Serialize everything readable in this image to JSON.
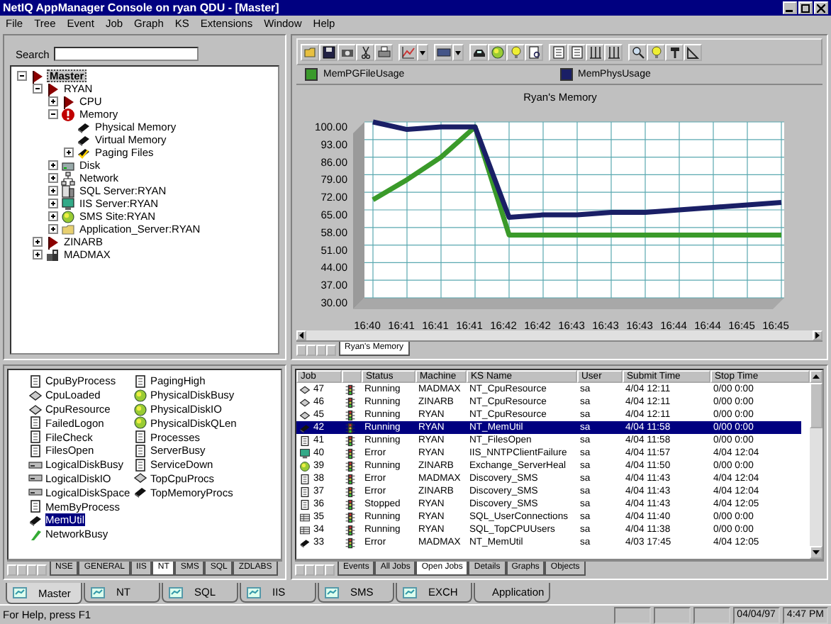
{
  "window": {
    "title": "NetIQ AppManager Console on ryan QDU - [Master]"
  },
  "menu": [
    "File",
    "Tree",
    "Event",
    "Job",
    "Graph",
    "KS",
    "Extensions",
    "Window",
    "Help"
  ],
  "search": {
    "label": "Search"
  },
  "tree": [
    {
      "label": "Master",
      "kind": "flag",
      "expanded": true,
      "selected": true,
      "children": [
        {
          "label": "RYAN",
          "kind": "flag",
          "expanded": true,
          "selected": false,
          "children": [
            {
              "label": "CPU",
              "kind": "flag",
              "expanded": false,
              "selected": false
            },
            {
              "label": "Memory",
              "kind": "alert",
              "expanded": true,
              "selected": false,
              "children": [
                {
                  "label": "Physical Memory",
                  "kind": "chip",
                  "selected": false
                },
                {
                  "label": "Virtual Memory",
                  "kind": "chip",
                  "selected": false
                },
                {
                  "label": "Paging Files",
                  "kind": "chipcheck",
                  "expanded": false,
                  "selected": false
                }
              ]
            },
            {
              "label": "Disk",
              "kind": "disk",
              "expanded": false,
              "selected": false
            },
            {
              "label": "Network",
              "kind": "network",
              "expanded": false,
              "selected": false
            },
            {
              "label": "SQL Server:RYAN",
              "kind": "server",
              "expanded": false,
              "selected": false
            },
            {
              "label": "IIS Server:RYAN",
              "kind": "monitor",
              "expanded": false,
              "selected": false
            },
            {
              "label": "SMS Site:RYAN",
              "kind": "globe",
              "expanded": false,
              "selected": false
            },
            {
              "label": "Application_Server:RYAN",
              "kind": "folder",
              "expanded": false,
              "selected": false
            }
          ]
        },
        {
          "label": "ZINARB",
          "kind": "flag",
          "expanded": false,
          "selected": false
        },
        {
          "label": "MADMAX",
          "kind": "machine",
          "expanded": false,
          "selected": false
        }
      ]
    }
  ],
  "scripts": {
    "items": [
      {
        "label": "CpuByProcess",
        "kind": "page",
        "selected": false
      },
      {
        "label": "CpuLoaded",
        "kind": "diamond",
        "selected": false
      },
      {
        "label": "CpuResource",
        "kind": "diamond",
        "selected": false
      },
      {
        "label": "FailedLogon",
        "kind": "page",
        "selected": false
      },
      {
        "label": "FileCheck",
        "kind": "page",
        "selected": false
      },
      {
        "label": "FilesOpen",
        "kind": "page",
        "selected": false
      },
      {
        "label": "LogicalDiskBusy",
        "kind": "drive",
        "selected": false
      },
      {
        "label": "LogicalDiskIO",
        "kind": "drive",
        "selected": false
      },
      {
        "label": "LogicalDiskSpace",
        "kind": "drive",
        "selected": false
      },
      {
        "label": "MemByProcess",
        "kind": "page",
        "selected": false
      },
      {
        "label": "MemUtil",
        "kind": "chip",
        "selected": true
      },
      {
        "label": "NetworkBusy",
        "kind": "plug",
        "selected": false
      },
      {
        "label": "PagingHigh",
        "kind": "page",
        "selected": false
      },
      {
        "label": "PhysicalDiskBusy",
        "kind": "globe",
        "selected": false
      },
      {
        "label": "PhysicalDiskIO",
        "kind": "globe",
        "selected": false
      },
      {
        "label": "PhysicalDiskQLen",
        "kind": "globe",
        "selected": false
      },
      {
        "label": "Processes",
        "kind": "page",
        "selected": false
      },
      {
        "label": "ServerBusy",
        "kind": "page",
        "selected": false
      },
      {
        "label": "ServiceDown",
        "kind": "page",
        "selected": false
      },
      {
        "label": "TopCpuProcs",
        "kind": "diamond",
        "selected": false
      },
      {
        "label": "TopMemoryProcs",
        "kind": "chip",
        "selected": false
      }
    ],
    "tabs": [
      {
        "label": "NSE",
        "selected": false
      },
      {
        "label": "GENERAL",
        "selected": false
      },
      {
        "label": "IIS",
        "selected": false
      },
      {
        "label": "NT",
        "selected": true
      },
      {
        "label": "SMS",
        "selected": false
      },
      {
        "label": "SQL",
        "selected": false
      },
      {
        "label": "ZDLABS",
        "selected": false
      }
    ]
  },
  "graph": {
    "tabs": [
      {
        "label": "Ryan's Memory",
        "selected": true
      }
    ],
    "chart_data": {
      "type": "line",
      "title": "Ryan's Memory",
      "categories": [
        "16:40",
        "16:41",
        "16:41",
        "16:41",
        "16:42",
        "16:42",
        "16:43",
        "16:43",
        "16:43",
        "16:44",
        "16:44",
        "16:45",
        "16:45"
      ],
      "series": [
        {
          "name": "MemPGFileUsage",
          "color": "#3a9a2a",
          "values": [
            69,
            77,
            86,
            98,
            55,
            55,
            55,
            55,
            55,
            55,
            55,
            55,
            55
          ]
        },
        {
          "name": "MemPhysUsage",
          "color": "#1a1f66",
          "values": [
            100,
            97,
            98,
            98,
            62,
            63,
            63,
            64,
            64,
            65,
            66,
            67,
            68
          ]
        }
      ],
      "grid": true,
      "ylim": [
        30,
        100
      ],
      "yticks": [
        {
          "value": 30,
          "label": "30.00"
        },
        {
          "value": 37,
          "label": "37.00"
        },
        {
          "value": 44,
          "label": "44.00"
        },
        {
          "value": 51,
          "label": "51.00"
        },
        {
          "value": 58,
          "label": "58.00"
        },
        {
          "value": 65,
          "label": "65.00"
        },
        {
          "value": 72,
          "label": "72.00"
        },
        {
          "value": 79,
          "label": "79.00"
        },
        {
          "value": 86,
          "label": "86.00"
        },
        {
          "value": 93,
          "label": "93.00"
        },
        {
          "value": 100,
          "label": "100.00"
        }
      ]
    }
  },
  "jobs": {
    "columns": [
      "Job",
      "Status",
      "Machine",
      "KS Name",
      "User",
      "Submit Time",
      "Stop Time"
    ],
    "rows": [
      {
        "job": "47",
        "kind": "diamond",
        "status": "Running",
        "machine": "MADMAX",
        "ks_name": "NT_CpuResource",
        "user": "sa",
        "submit_time": "4/04 12:11",
        "stop_time": "0/00  0:00",
        "selected": false
      },
      {
        "job": "46",
        "kind": "diamond",
        "status": "Running",
        "machine": "ZINARB",
        "ks_name": "NT_CpuResource",
        "user": "sa",
        "submit_time": "4/04 12:11",
        "stop_time": "0/00  0:00",
        "selected": false
      },
      {
        "job": "45",
        "kind": "diamond",
        "status": "Running",
        "machine": "RYAN",
        "ks_name": "NT_CpuResource",
        "user": "sa",
        "submit_time": "4/04 12:11",
        "stop_time": "0/00  0:00",
        "selected": false
      },
      {
        "job": "42",
        "kind": "chip",
        "status": "Running",
        "machine": "RYAN",
        "ks_name": "NT_MemUtil",
        "user": "sa",
        "submit_time": "4/04 11:58",
        "stop_time": "0/00  0:00",
        "selected": true
      },
      {
        "job": "41",
        "kind": "page",
        "status": "Running",
        "machine": "RYAN",
        "ks_name": "NT_FilesOpen",
        "user": "sa",
        "submit_time": "4/04 11:58",
        "stop_time": "0/00  0:00",
        "selected": false
      },
      {
        "job": "40",
        "kind": "monitor",
        "status": "Error",
        "machine": "RYAN",
        "ks_name": "IIS_NNTPClientFailure",
        "user": "sa",
        "submit_time": "4/04 11:57",
        "stop_time": "4/04 12:04",
        "selected": false
      },
      {
        "job": "39",
        "kind": "globe",
        "status": "Running",
        "machine": "ZINARB",
        "ks_name": "Exchange_ServerHeal",
        "user": "sa",
        "submit_time": "4/04 11:50",
        "stop_time": "0/00  0:00",
        "selected": false
      },
      {
        "job": "38",
        "kind": "page",
        "status": "Error",
        "machine": "MADMAX",
        "ks_name": "Discovery_SMS",
        "user": "sa",
        "submit_time": "4/04 11:43",
        "stop_time": "4/04 12:04",
        "selected": false
      },
      {
        "job": "37",
        "kind": "page",
        "status": "Error",
        "machine": "ZINARB",
        "ks_name": "Discovery_SMS",
        "user": "sa",
        "submit_time": "4/04 11:43",
        "stop_time": "4/04 12:04",
        "selected": false
      },
      {
        "job": "36",
        "kind": "page",
        "status": "Stopped",
        "machine": "RYAN",
        "ks_name": "Discovery_SMS",
        "user": "sa",
        "submit_time": "4/04 11:43",
        "stop_time": "4/04 12:05",
        "selected": false
      },
      {
        "job": "35",
        "kind": "grid",
        "status": "Running",
        "machine": "RYAN",
        "ks_name": "SQL_UserConnections",
        "user": "sa",
        "submit_time": "4/04 11:40",
        "stop_time": "0/00  0:00",
        "selected": false
      },
      {
        "job": "34",
        "kind": "grid",
        "status": "Running",
        "machine": "RYAN",
        "ks_name": "SQL_TopCPUUsers",
        "user": "sa",
        "submit_time": "4/04 11:38",
        "stop_time": "0/00  0:00",
        "selected": false
      },
      {
        "job": "33",
        "kind": "chip",
        "status": "Error",
        "machine": "MADMAX",
        "ks_name": "NT_MemUtil",
        "user": "sa",
        "submit_time": "4/03 17:45",
        "stop_time": "4/04 12:05",
        "selected": false
      }
    ],
    "tabs": [
      {
        "label": "Events",
        "selected": false
      },
      {
        "label": "All Jobs",
        "selected": false
      },
      {
        "label": "Open Jobs",
        "selected": true
      },
      {
        "label": "Details",
        "selected": false
      },
      {
        "label": "Graphs",
        "selected": false
      },
      {
        "label": "Objects",
        "selected": false
      }
    ]
  },
  "console_tabs": [
    {
      "label": "Master",
      "selected": true
    },
    {
      "label": "NT",
      "selected": false
    },
    {
      "label": "SQL",
      "selected": false
    },
    {
      "label": "IIS",
      "selected": false
    },
    {
      "label": "SMS",
      "selected": false
    },
    {
      "label": "EXCH",
      "selected": false
    },
    {
      "label": "Application",
      "selected": false
    }
  ],
  "status_bar": {
    "help": "For Help, press F1",
    "date": "04/04/97",
    "time": "4:47 PM"
  }
}
